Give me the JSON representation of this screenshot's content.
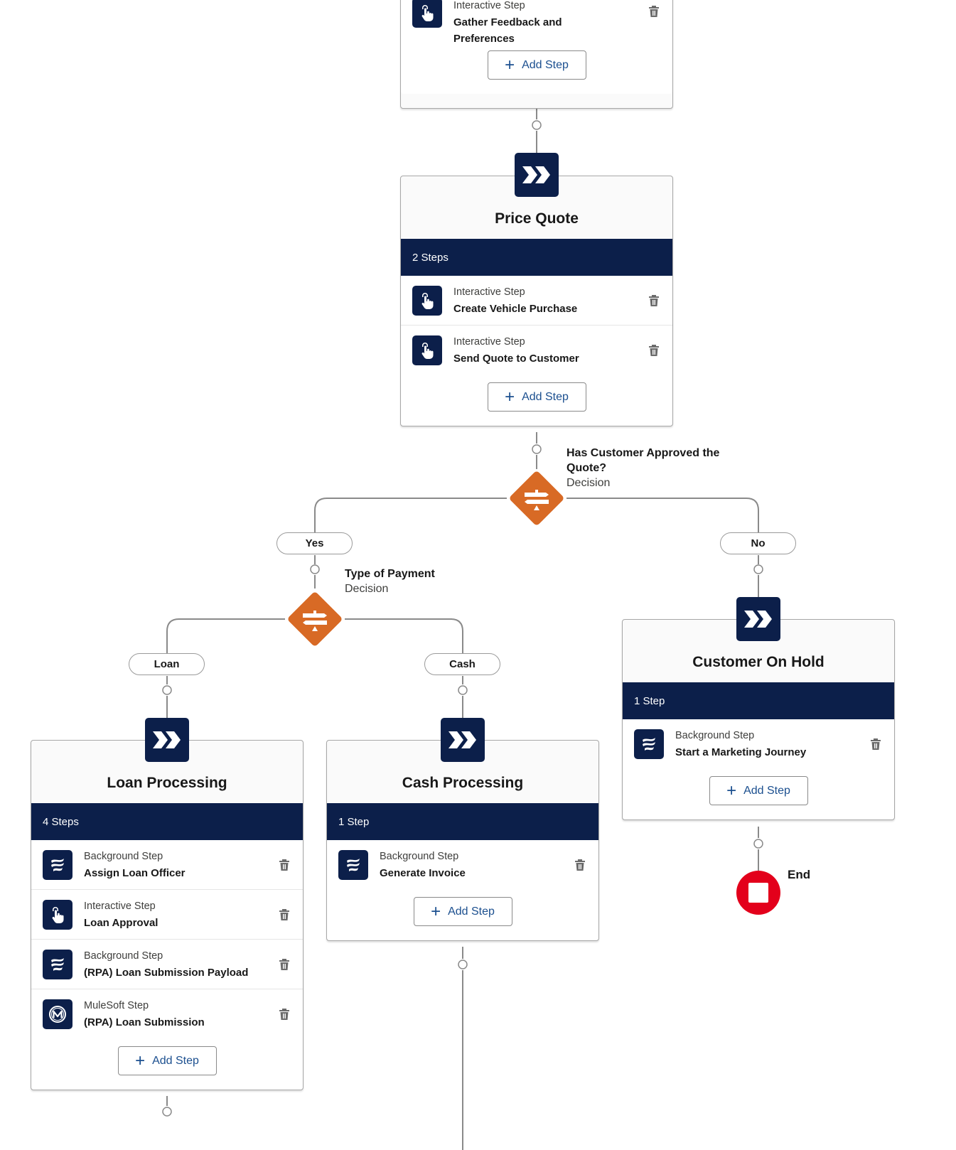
{
  "colors": {
    "navy": "#0c1f4a",
    "decision_orange": "#d86a25",
    "end_red": "#e3001b",
    "connector_gray": "#8a8a8a",
    "add_step_blue": "#1b4f8f"
  },
  "add_step_label": "Add Step",
  "stages": {
    "gather": {
      "steps": [
        {
          "type": "Interactive Step",
          "name": "Gather Feedback and Preferences",
          "icon": "touch-icon"
        }
      ]
    },
    "price_quote": {
      "title": "Price Quote",
      "count": "2 Steps",
      "steps": [
        {
          "type": "Interactive Step",
          "name": "Create Vehicle Purchase",
          "icon": "touch-icon"
        },
        {
          "type": "Interactive Step",
          "name": "Send Quote to Customer",
          "icon": "touch-icon"
        }
      ]
    },
    "customer_on_hold": {
      "title": "Customer On Hold",
      "count": "1 Step",
      "steps": [
        {
          "type": "Background Step",
          "name": "Start a Marketing Journey",
          "icon": "background-flow-icon"
        }
      ]
    },
    "loan_processing": {
      "title": "Loan Processing",
      "count": "4 Steps",
      "steps": [
        {
          "type": "Background Step",
          "name": "Assign Loan Officer",
          "icon": "background-flow-icon"
        },
        {
          "type": "Interactive Step",
          "name": "Loan Approval",
          "icon": "touch-icon"
        },
        {
          "type": "Background Step",
          "name": "(RPA) Loan Submission Payload",
          "icon": "background-flow-icon"
        },
        {
          "type": "MuleSoft Step",
          "name": "(RPA) Loan Submission",
          "icon": "mulesoft-icon"
        }
      ]
    },
    "cash_processing": {
      "title": "Cash Processing",
      "count": "1 Step",
      "steps": [
        {
          "type": "Background Step",
          "name": "Generate Invoice",
          "icon": "background-flow-icon"
        }
      ]
    }
  },
  "decisions": {
    "approved": {
      "title": "Has Customer Approved the Quote?",
      "subtitle": "Decision",
      "branches": [
        "Yes",
        "No"
      ]
    },
    "payment": {
      "title": "Type of Payment",
      "subtitle": "Decision",
      "branches": [
        "Loan",
        "Cash"
      ]
    }
  },
  "end": {
    "label": "End"
  }
}
